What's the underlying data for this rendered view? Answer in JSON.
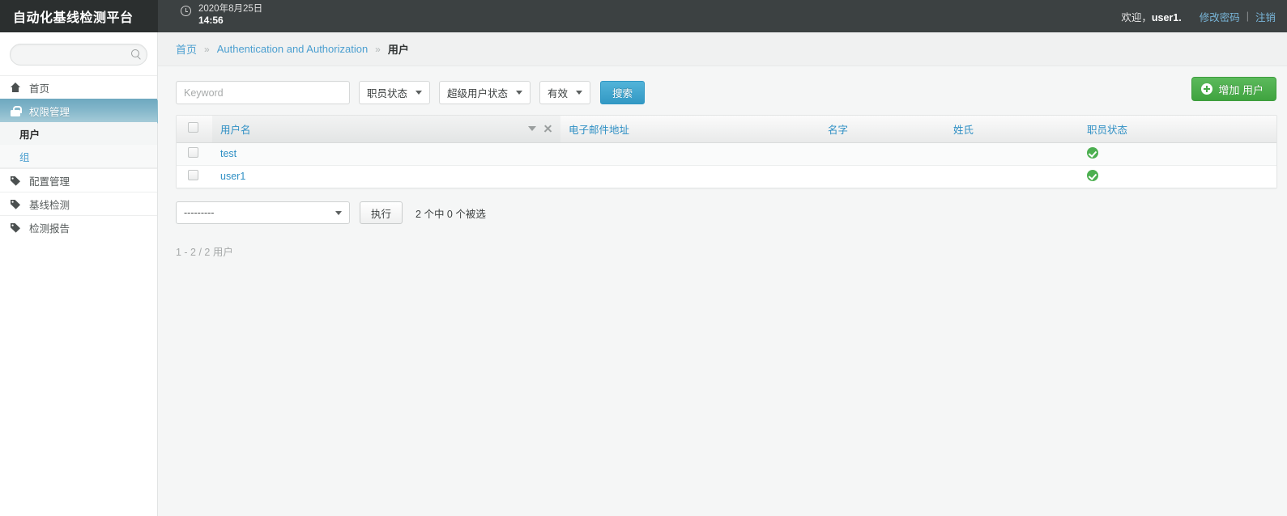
{
  "topbar": {
    "brand": "自动化基线检测平台",
    "clock_icon": "clock-icon",
    "date": "2020年8月25日",
    "time": "14:56",
    "welcome_prefix": "欢迎，",
    "welcome_user": "user1.",
    "change_password": "修改密码",
    "separator": "|",
    "logout": "注销"
  },
  "sidebar": {
    "search_placeholder": "",
    "search_icon": "search-icon",
    "items": [
      {
        "label": "首页",
        "icon": "home-icon",
        "active": false
      },
      {
        "label": "权限管理",
        "icon": "lock-icon",
        "active": true
      },
      {
        "label": "配置管理",
        "icon": "tags-icon",
        "active": false
      },
      {
        "label": "基线检测",
        "icon": "tags-icon",
        "active": false
      },
      {
        "label": "检测报告",
        "icon": "tags-icon",
        "active": false
      }
    ],
    "sub_items": [
      {
        "label": "用户",
        "current": true
      },
      {
        "label": "组",
        "current": false
      }
    ]
  },
  "breadcrumb": {
    "home": "首页",
    "sep": "»",
    "section": "Authentication and Authorization",
    "current": "用户"
  },
  "filters": {
    "keyword_value": "",
    "keyword_placeholder": "Keyword",
    "staff_status": "职员状态",
    "superuser_status": "超级用户状态",
    "active": "有效",
    "search_button": "搜索",
    "add_button": "增加 用户",
    "add_icon": "plus-circle-icon"
  },
  "table": {
    "headers": {
      "username": "用户名",
      "email": "电子邮件地址",
      "first_name": "名字",
      "last_name": "姓氏",
      "staff_status": "职员状态"
    },
    "sort_icons": {
      "chevron": "chevron-down-icon",
      "clear": "close-icon"
    },
    "rows": [
      {
        "username": "test",
        "email": "",
        "first_name": "",
        "last_name": "",
        "staff_status_icon": "check-circle-icon"
      },
      {
        "username": "user1",
        "email": "",
        "first_name": "",
        "last_name": "",
        "staff_status_icon": "check-circle-icon"
      }
    ]
  },
  "actions": {
    "select_value": "---------",
    "run_button": "执行",
    "selection_count": "2 个中 0 个被选"
  },
  "paging": {
    "summary": "1 - 2  /  2 用户"
  },
  "colors": {
    "topbar": "#3c4142",
    "brand_bg": "#2b2f2f",
    "accent_blue": "#2e8fc4",
    "active_nav": "#86b8cb",
    "add_green": "#45a845",
    "ok_green": "#4caf50"
  }
}
